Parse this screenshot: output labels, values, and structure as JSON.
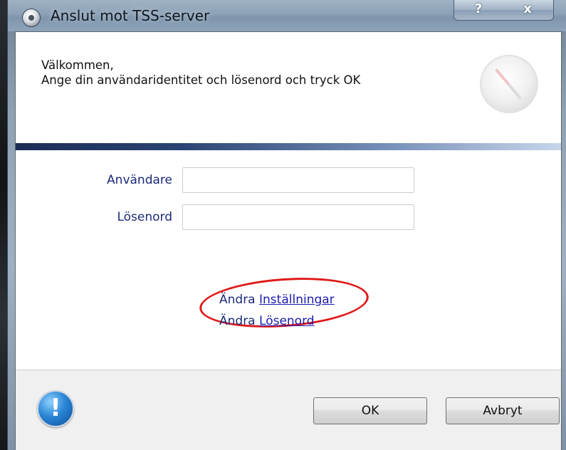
{
  "window": {
    "title": "Anslut mot TSS-server",
    "help_label": "?",
    "close_label": "x"
  },
  "header": {
    "welcome_line1": "Välkommen,",
    "welcome_line2": "Ange din användaridentitet och lösenord och tryck OK"
  },
  "form": {
    "user_label": "Användare",
    "user_value": "",
    "password_label": "Lösenord",
    "password_value": ""
  },
  "links": {
    "settings_prefix": "Ändra",
    "settings_link": "Inställningar",
    "password_prefix": "Ändra",
    "password_link": "Lösenord"
  },
  "footer": {
    "info_glyph": "!",
    "ok_label": "OK",
    "cancel_label": "Avbryt"
  },
  "colors": {
    "label_text": "#1b2a7a",
    "link": "#1b1bb0",
    "annotation": "#e01a1a",
    "band": "#2b4274"
  },
  "icons": [
    "app-icon",
    "compass-icon",
    "info-icon"
  ]
}
